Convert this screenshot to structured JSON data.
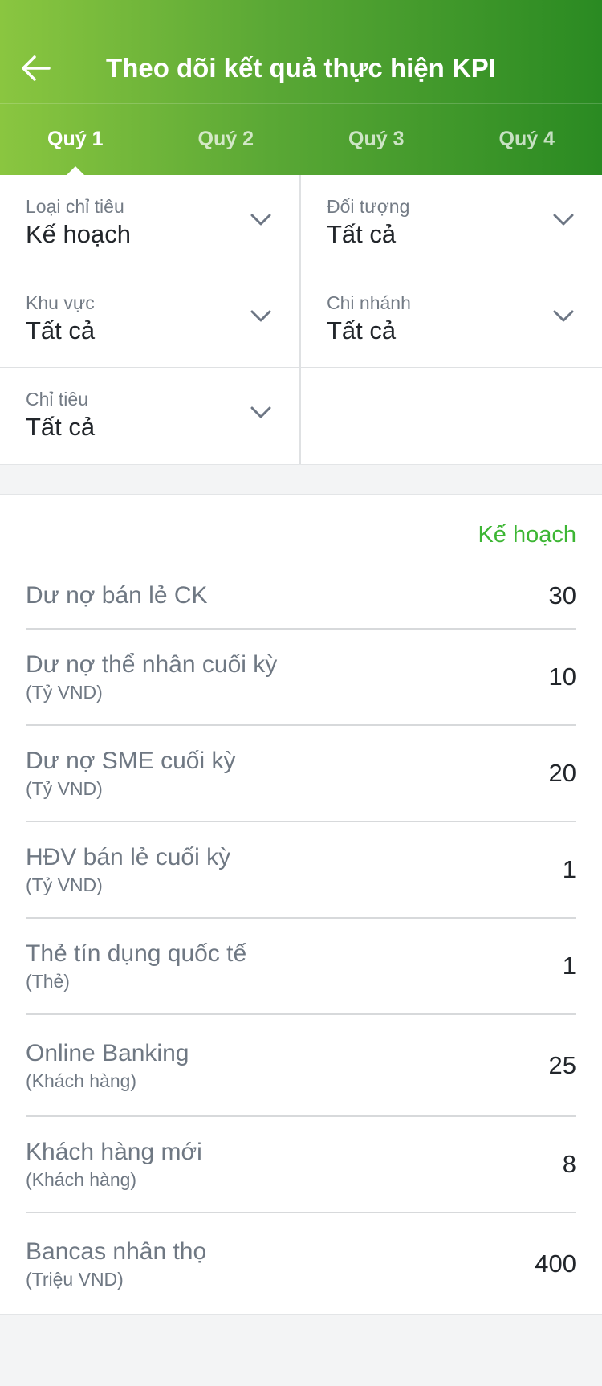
{
  "header": {
    "title": "Theo dõi kết quả thực hiện KPI",
    "back_icon": "arrow-left-icon",
    "gradient": [
      "#8ac640",
      "#2a8a22"
    ]
  },
  "tabs": [
    {
      "label": "Quý 1",
      "active": true
    },
    {
      "label": "Quý 2",
      "active": false
    },
    {
      "label": "Quý 3",
      "active": false
    },
    {
      "label": "Quý 4",
      "active": false
    }
  ],
  "filters": [
    {
      "label": "Loại chỉ tiêu",
      "value": "Kế hoạch"
    },
    {
      "label": "Đối tượng",
      "value": "Tất cả"
    },
    {
      "label": "Khu vực",
      "value": "Tất cả"
    },
    {
      "label": "Chi nhánh",
      "value": "Tất cả"
    },
    {
      "label": "Chỉ tiêu",
      "value": "Tất cả"
    }
  ],
  "kpi": {
    "column_header": "Kế hoạch",
    "accent": "#3db634",
    "rows": [
      {
        "name": "Dư nợ bán lẻ CK",
        "unit": "",
        "value": "30"
      },
      {
        "name": "Dư nợ thể nhân cuối kỳ",
        "unit": "(Tỷ VND)",
        "value": "10"
      },
      {
        "name": "Dư nợ SME cuối kỳ",
        "unit": "(Tỷ VND)",
        "value": "20"
      },
      {
        "name": "HĐV bán lẻ cuối kỳ",
        "unit": "(Tỷ VND)",
        "value": "1"
      },
      {
        "name": "Thẻ tín dụng quốc tế",
        "unit": "(Thẻ)",
        "value": "1"
      },
      {
        "name": "Online Banking",
        "unit": "(Khách hàng)",
        "value": "25"
      },
      {
        "name": "Khách hàng mới",
        "unit": "(Khách hàng)",
        "value": "8"
      },
      {
        "name": "Bancas nhân thọ",
        "unit": "(Triệu VND)",
        "value": "400"
      }
    ]
  }
}
